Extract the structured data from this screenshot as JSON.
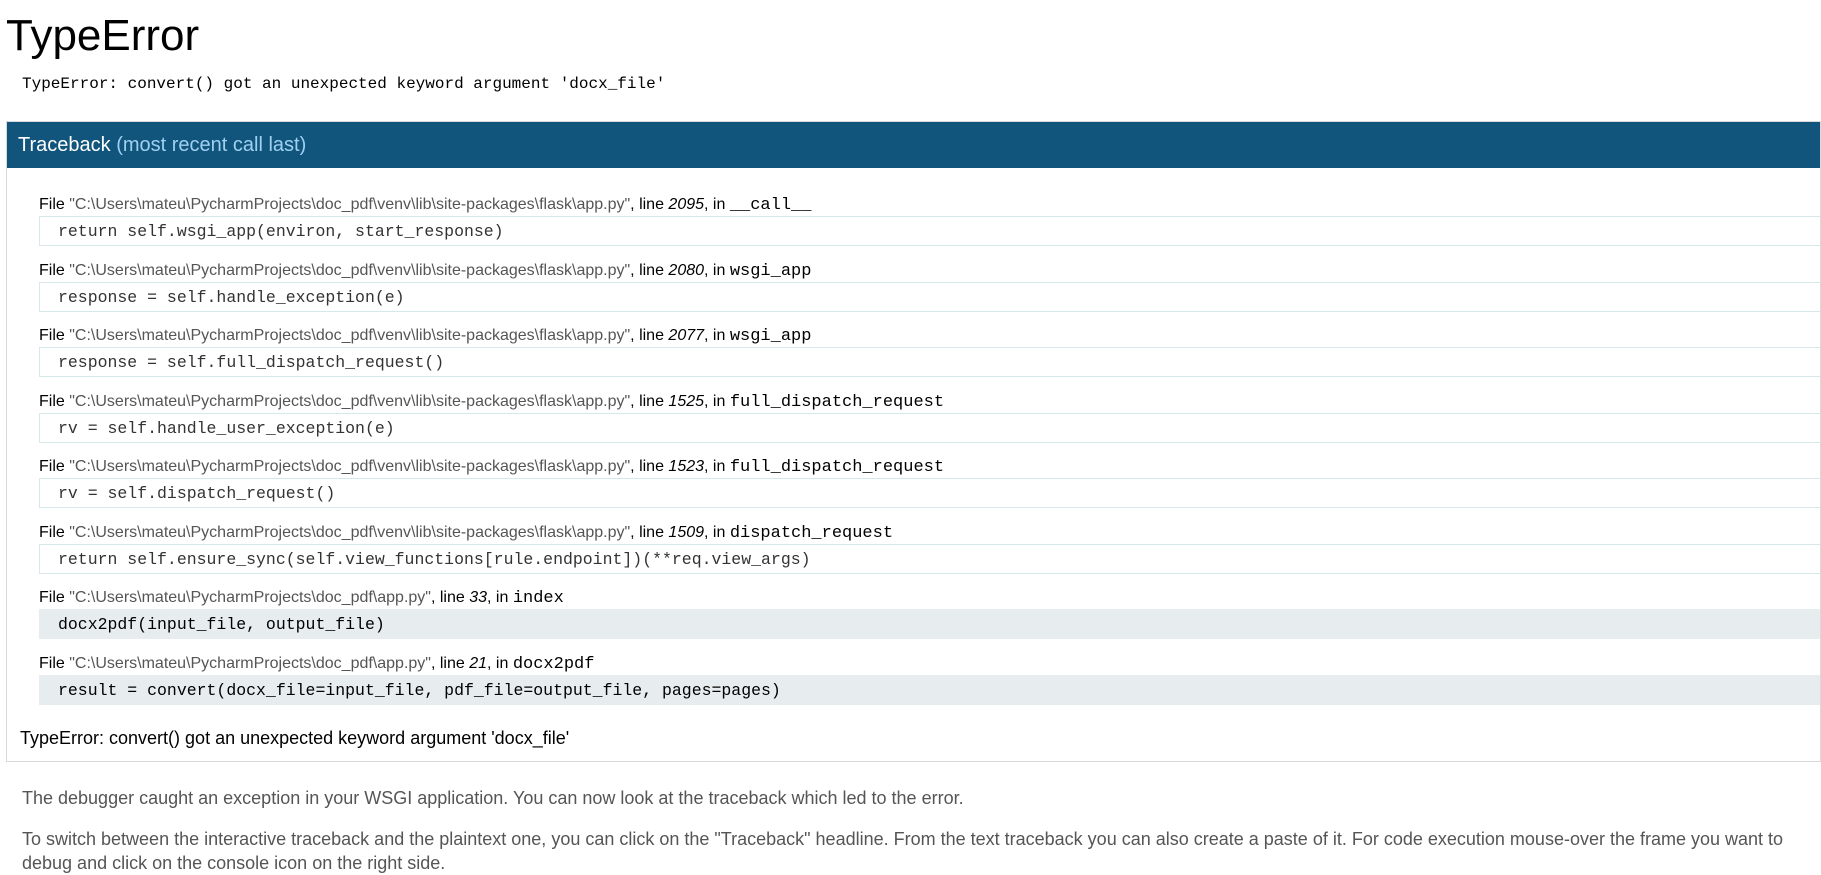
{
  "title": "TypeError",
  "summary": "TypeError: convert() got an unexpected keyword argument 'docx_file'",
  "traceback": {
    "header": "Traceback",
    "header_sub": "(most recent call last)",
    "frames": [
      {
        "prefix": "File ",
        "filename": "\"C:\\Users\\mateu\\PycharmProjects\\doc_pdf\\venv\\lib\\site-packages\\flask\\app.py\"",
        "line_label": ", line ",
        "lineno": "2095",
        "in_label": ", in ",
        "func": "__call__",
        "code": "return self.wsgi_app(environ, start_response)"
      },
      {
        "prefix": "File ",
        "filename": "\"C:\\Users\\mateu\\PycharmProjects\\doc_pdf\\venv\\lib\\site-packages\\flask\\app.py\"",
        "line_label": ", line ",
        "lineno": "2080",
        "in_label": ", in ",
        "func": "wsgi_app",
        "code": "response = self.handle_exception(e)"
      },
      {
        "prefix": "File ",
        "filename": "\"C:\\Users\\mateu\\PycharmProjects\\doc_pdf\\venv\\lib\\site-packages\\flask\\app.py\"",
        "line_label": ", line ",
        "lineno": "2077",
        "in_label": ", in ",
        "func": "wsgi_app",
        "code": "response = self.full_dispatch_request()"
      },
      {
        "prefix": "File ",
        "filename": "\"C:\\Users\\mateu\\PycharmProjects\\doc_pdf\\venv\\lib\\site-packages\\flask\\app.py\"",
        "line_label": ", line ",
        "lineno": "1525",
        "in_label": ", in ",
        "func": "full_dispatch_request",
        "code": "rv = self.handle_user_exception(e)"
      },
      {
        "prefix": "File ",
        "filename": "\"C:\\Users\\mateu\\PycharmProjects\\doc_pdf\\venv\\lib\\site-packages\\flask\\app.py\"",
        "line_label": ", line ",
        "lineno": "1523",
        "in_label": ", in ",
        "func": "full_dispatch_request",
        "code": "rv = self.dispatch_request()"
      },
      {
        "prefix": "File ",
        "filename": "\"C:\\Users\\mateu\\PycharmProjects\\doc_pdf\\venv\\lib\\site-packages\\flask\\app.py\"",
        "line_label": ", line ",
        "lineno": "1509",
        "in_label": ", in ",
        "func": "dispatch_request",
        "code": "return self.ensure_sync(self.view_functions[rule.endpoint])(**req.view_args)"
      },
      {
        "prefix": "File ",
        "filename": "\"C:\\Users\\mateu\\PycharmProjects\\doc_pdf\\app.py\"",
        "line_label": ", line ",
        "lineno": "33",
        "in_label": ", in ",
        "func": "index",
        "code": "docx2pdf(input_file, output_file)"
      },
      {
        "prefix": "File ",
        "filename": "\"C:\\Users\\mateu\\PycharmProjects\\doc_pdf\\app.py\"",
        "line_label": ", line ",
        "lineno": "21",
        "in_label": ", in ",
        "func": "docx2pdf",
        "code": "result = convert(docx_file=input_file, pdf_file=output_file, pages=pages)"
      }
    ],
    "final_error": "TypeError: convert() got an unexpected keyword argument 'docx_file'"
  },
  "explanation": {
    "p1": "The debugger caught an exception in your WSGI application. You can now look at the traceback which led to the error.",
    "p2": "To switch between the interactive traceback and the plaintext one, you can click on the \"Traceback\" headline. From the text traceback you can also create a paste of it. For code execution mouse-over the frame you want to debug and click on the console icon on the right side."
  }
}
